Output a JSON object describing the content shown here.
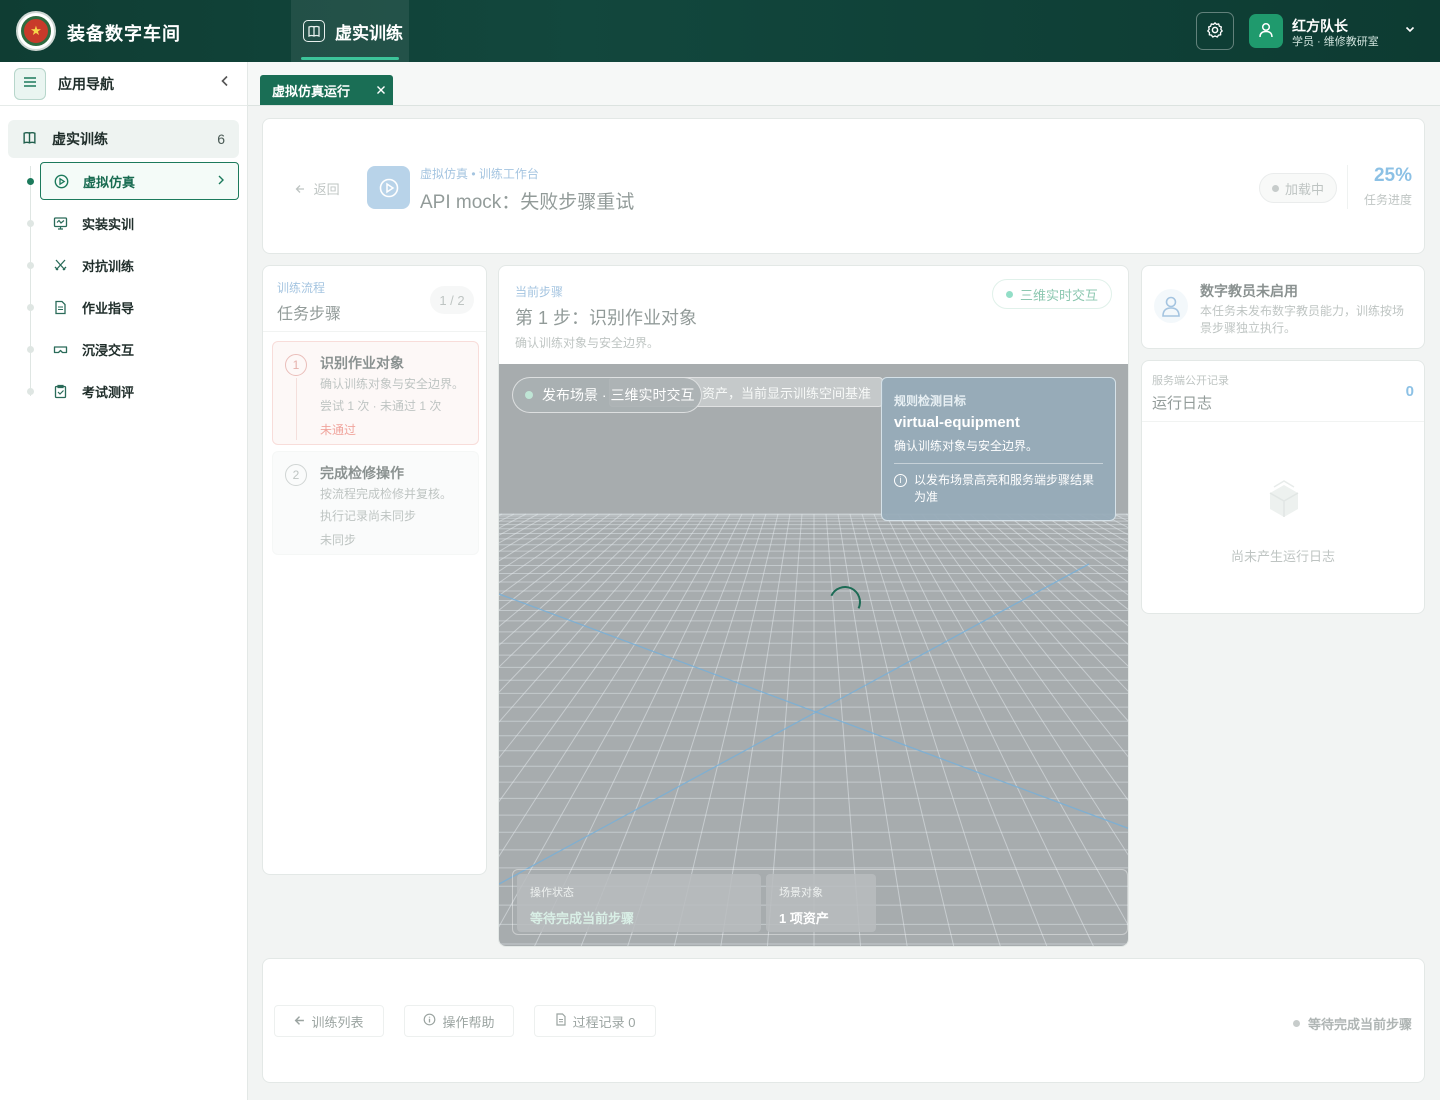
{
  "topbar": {
    "brand": "装备数字车间",
    "logo_text": "★",
    "tab_label": "虚实训练",
    "user_name": "红方队长",
    "user_role": "学员 · 维修教研室"
  },
  "sidebar": {
    "title": "应用导航",
    "group": {
      "label": "虚实训练",
      "count": "6"
    },
    "items": [
      {
        "label": "虚拟仿真",
        "icon": "play-circle-icon",
        "active": true
      },
      {
        "label": "实装实训",
        "icon": "monitor-icon"
      },
      {
        "label": "对抗训练",
        "icon": "swords-icon"
      },
      {
        "label": "作业指导",
        "icon": "document-icon"
      },
      {
        "label": "沉浸交互",
        "icon": "vr-headset-icon"
      },
      {
        "label": "考试测评",
        "icon": "clipboard-check-icon"
      }
    ]
  },
  "tabs": [
    {
      "label": "虚拟仿真运行"
    }
  ],
  "header": {
    "back_label": "返回",
    "breadcrumb": "虚拟仿真 • 训练工作台",
    "title": "API mock：失败步骤重试",
    "status": "加载中",
    "progress": "25%",
    "progress_label": "任务进度"
  },
  "steps_panel": {
    "kicker": "训练流程",
    "title": "任务步骤",
    "count": "1 / 2",
    "steps": [
      {
        "num": "1",
        "title": "识别作业对象",
        "desc": "确认训练对象与安全边界。",
        "meta": "尝试 1 次 · 未通过 1 次",
        "status": "未通过"
      },
      {
        "num": "2",
        "title": "完成检修操作",
        "desc": "按流程完成检修并复核。",
        "meta": "执行记录尚未同步",
        "status": "未同步"
      }
    ]
  },
  "current_step": {
    "kicker": "当前步骤",
    "title": "第 1 步：识别作业对象",
    "desc": "确认训练对象与安全边界。",
    "mode": "三维实时交互",
    "viewport": {
      "notice": "资产，当前显示训练空间基准",
      "scene_pill": "发布场景 · 三维实时交互",
      "target_kicker": "规则检测目标",
      "target_name": "virtual-equipment",
      "target_desc": "确认训练对象与安全边界。",
      "target_note": "以发布场景高亮和服务端步骤结果为准",
      "info_glyph": "i",
      "op_status_label": "操作状态",
      "op_status_value": "等待完成当前步骤",
      "scene_obj_label": "场景对象",
      "scene_obj_value": "1 项资产"
    }
  },
  "coach": {
    "title": "数字教员未启用",
    "desc": "本任务未发布数字教员能力，训练按场景步骤独立执行。"
  },
  "logs": {
    "kicker": "服务端公开记录",
    "title": "运行日志",
    "count": "0",
    "empty": "尚未产生运行日志"
  },
  "footer": {
    "btn_list": "训练列表",
    "btn_help": "操作帮助",
    "btn_record": "过程记录 0",
    "status": "等待完成当前步骤"
  },
  "colors": {
    "brand_dark": "#0f3d33",
    "accent": "#1c7a5c",
    "link_blue": "#2f8fd0",
    "error": "#e45a4c"
  }
}
